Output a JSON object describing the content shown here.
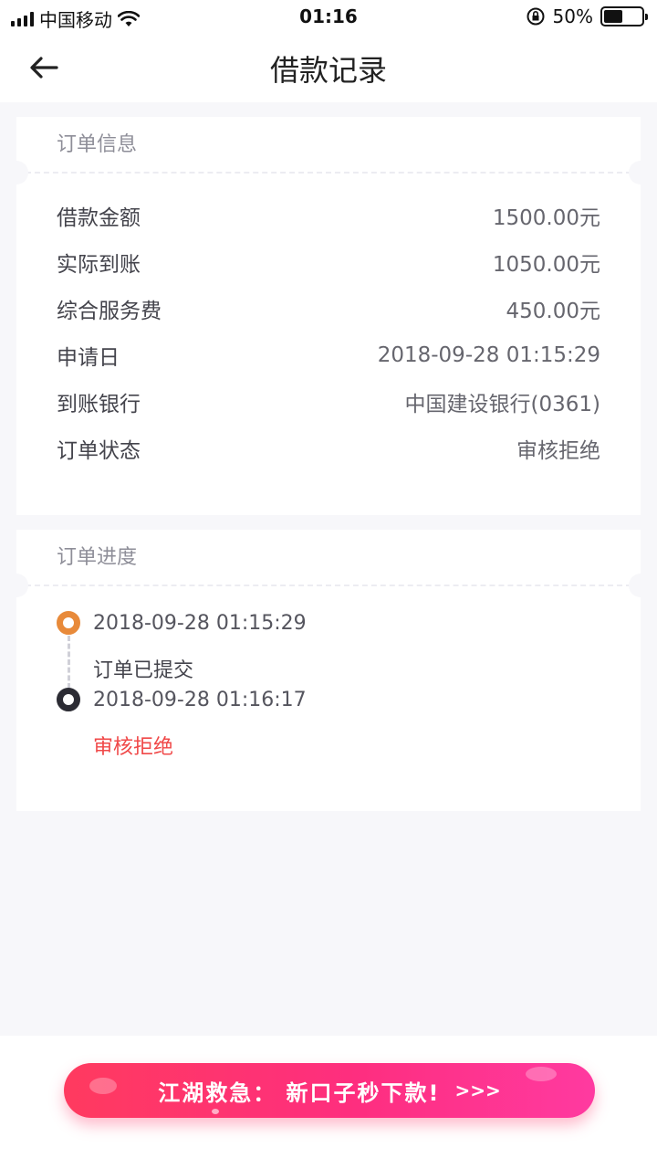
{
  "status_bar": {
    "carrier": "中国移动",
    "time": "01:16",
    "battery": "50%",
    "battery_level": 0.5
  },
  "nav": {
    "title": "借款记录"
  },
  "order_info": {
    "heading": "订单信息",
    "rows": [
      {
        "label": "借款金额",
        "value": "1500.00元"
      },
      {
        "label": "实际到账",
        "value": "1050.00元"
      },
      {
        "label": "综合服务费",
        "value": "450.00元"
      },
      {
        "label": "申请日",
        "value": "2018-09-28 01:15:29"
      },
      {
        "label": "到账银行",
        "value": "中国建设银行(0361)"
      },
      {
        "label": "订单状态",
        "value": "审核拒绝"
      }
    ]
  },
  "order_progress": {
    "heading": "订单进度",
    "steps": [
      {
        "time": "2018-09-28 01:15:29",
        "text": "订单已提交",
        "color": "#e88a3a"
      },
      {
        "time": "2018-09-28 01:16:17",
        "text": "审核拒绝",
        "color": "#f04848"
      }
    ]
  },
  "banner": {
    "text": "江湖救急： 新口子秒下款!",
    "arrows": ">>>"
  },
  "colors": {
    "accent_orange": "#e88a3a",
    "reject_red": "#f04848",
    "banner_pink": "#fe2e7f"
  }
}
